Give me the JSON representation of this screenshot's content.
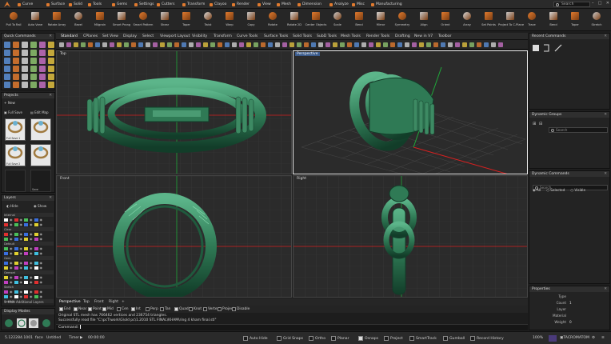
{
  "ribbon": {
    "tabs": [
      "Curve",
      "Surface",
      "Solid",
      "Tools",
      "Gems",
      "Settings",
      "Cutters",
      "Transform",
      "Clayoo",
      "Render",
      "View",
      "Mesh",
      "Dimension",
      "Analyze",
      "Misc",
      "Manufacturing"
    ],
    "search_placeholder": "Search",
    "window_controls": [
      "–",
      "□",
      "✕"
    ]
  },
  "toolbar": {
    "tools": [
      "Pull To Rail",
      "Auto Vane",
      "Rotate Array",
      "Bezel",
      "Milgrain",
      "Smart Prong",
      "Smart Pattern",
      "Shear",
      "Taper",
      "Twist",
      "Warp",
      "Copy",
      "Rotate",
      "Rotate 2D",
      "Center Objects",
      "Scale",
      "Bend",
      "Mirror",
      "Symmetry",
      "Align",
      "Orient",
      "Array",
      "Set Points",
      "Project To C-Plane",
      "Trace",
      "Bend",
      "Taper",
      "Stretch"
    ]
  },
  "quick_commands": {
    "title": "Quick Commands"
  },
  "projects": {
    "title": "Projects",
    "new_label": "New",
    "full_save_label": "Full Save",
    "edit_map_label": "Edit Map",
    "thumbs": [
      "Full Save 1",
      "",
      "Full Save 2",
      "",
      "",
      "Save"
    ]
  },
  "layers": {
    "title": "Layers",
    "hide_label": "Hide",
    "show_label": "Show",
    "groups": [
      "Internal",
      "Clear",
      "Default",
      "Gem",
      "Gemset",
      "Sketch",
      "Scale A"
    ],
    "hide_additional": "Hide Additional Layers"
  },
  "display_modes": {
    "title": "Display Modes"
  },
  "viewport_tabs": [
    "Standard",
    "CPlanes",
    "Set View",
    "Display",
    "Select",
    "Viewport Layout",
    "Visibility",
    "Transform",
    "Curve Tools",
    "Surface Tools",
    "Solid Tools",
    "SubD Tools",
    "Mesh Tools",
    "Render Tools",
    "Drafting",
    "New in V7",
    "Toolbar"
  ],
  "viewports": {
    "top": "Top",
    "perspective": "Perspective",
    "front": "Front",
    "right": "Right"
  },
  "bottom_tabs": [
    "Perspective",
    "Top",
    "Front",
    "Right"
  ],
  "snaps": [
    {
      "label": "End",
      "on": true
    },
    {
      "label": "Near",
      "on": true
    },
    {
      "label": "Point",
      "on": true
    },
    {
      "label": "Mid",
      "on": true
    },
    {
      "label": "Cen",
      "on": false
    },
    {
      "label": "Int",
      "on": true
    },
    {
      "label": "Perp",
      "on": false
    },
    {
      "label": "Tan",
      "on": false
    },
    {
      "label": "Quad",
      "on": true
    },
    {
      "label": "Knot",
      "on": false
    },
    {
      "label": "Vertex",
      "on": false
    },
    {
      "label": "Project",
      "on": false
    },
    {
      "label": "Disable",
      "on": false
    }
  ],
  "command": {
    "history_1": "Original STL mesh has 766462 vertices and 236754 triangles.",
    "history_2": "Successfully read file \"C:\\pcT\\work\\G\\old pc\\1.2010 STL FINAL\\KHAM\\ring 4 kham final.stl\"",
    "prompt": "Command:"
  },
  "status": {
    "coords": "5.122284.1001",
    "face": "face",
    "units": "Untitled",
    "timer_label": "Timer",
    "timer_value": "00:00:00",
    "toggles": [
      {
        "label": "Auto Hide",
        "on": false
      },
      {
        "label": "Grid Snaps",
        "on": false
      },
      {
        "label": "Ortho",
        "on": false
      },
      {
        "label": "Planar",
        "on": false
      },
      {
        "label": "Osnaps",
        "on": true
      },
      {
        "label": "Project",
        "on": false
      },
      {
        "label": "SmartTrack",
        "on": false
      },
      {
        "label": "Gumball",
        "on": false
      },
      {
        "label": "Record History",
        "on": false
      }
    ],
    "zoom": "100%",
    "brand": "TACROMATOM"
  },
  "recent_commands": {
    "title": "Recent Commands"
  },
  "dynamic_groups": {
    "title": "Dynamic Groups",
    "search": "Search"
  },
  "dynamic_commands": {
    "title": "Dynamic Commands",
    "search": "Search",
    "filters": [
      "All",
      "Selected",
      "Visible"
    ]
  },
  "properties": {
    "title": "Properties",
    "rows": [
      {
        "label": "Type",
        "value": ""
      },
      {
        "label": "Count",
        "value": "1"
      },
      {
        "label": "Layer",
        "value": ""
      },
      {
        "label": "Material",
        "value": ""
      },
      {
        "label": "Weight",
        "value": "0"
      }
    ]
  },
  "colors": {
    "accent": "#e07a2f",
    "ring": "#2f7a55",
    "grid": "#3a3a3a",
    "x_axis": "#d62020",
    "y_axis": "#1fa83a"
  }
}
